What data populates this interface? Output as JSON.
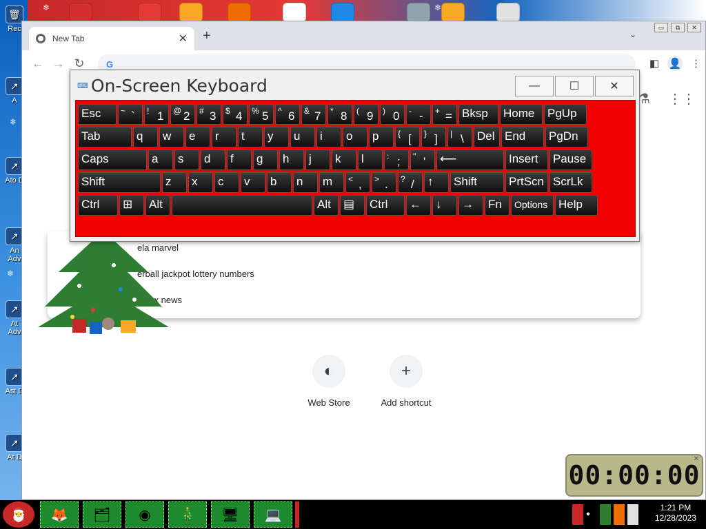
{
  "desktop": {
    "icons": [
      {
        "label": "Rec",
        "icon": "recycle-bin-icon"
      },
      {
        "label": "A",
        "icon": "shortcut-icon"
      },
      {
        "label": "Ato D",
        "icon": "shortcut-icon"
      },
      {
        "label": "An Adv",
        "icon": "shortcut-icon"
      },
      {
        "label": "At Adv",
        "icon": "shortcut-icon"
      },
      {
        "label": "Ast D",
        "icon": "shortcut-icon"
      },
      {
        "label": "At D",
        "icon": "shortcut-icon"
      }
    ]
  },
  "browser": {
    "tab": {
      "title": "New Tab"
    },
    "new_tab": "+",
    "tab_search": "⌄",
    "omnibox": {
      "google_mark": "G",
      "value": "",
      "placeholder": ""
    },
    "suggestions": [
      "ela marvel",
      "erball jackpot lottery numbers",
      "d sox news"
    ],
    "shortcuts": [
      {
        "label": "Web Store",
        "icon": "webstore-icon"
      },
      {
        "label": "Add shortcut",
        "icon": "plus-icon"
      }
    ]
  },
  "osk": {
    "title": "On-Screen Keyboard",
    "rows": [
      [
        {
          "main": "Esc",
          "w": 56
        },
        {
          "top": "~",
          "main": "`",
          "w": 36
        },
        {
          "top": "!",
          "main": "1",
          "w": 36
        },
        {
          "top": "@",
          "main": "2",
          "w": 36
        },
        {
          "top": "#",
          "main": "3",
          "w": 36
        },
        {
          "top": "$",
          "main": "4",
          "w": 36
        },
        {
          "top": "%",
          "main": "5",
          "w": 36
        },
        {
          "top": "^",
          "main": "6",
          "w": 36
        },
        {
          "top": "&",
          "main": "7",
          "w": 36
        },
        {
          "top": "*",
          "main": "8",
          "w": 36
        },
        {
          "top": "(",
          "main": "9",
          "w": 36
        },
        {
          "top": ")",
          "main": "0",
          "w": 36
        },
        {
          "top": "-",
          "main": "-",
          "w": 36
        },
        {
          "top": "+",
          "main": "=",
          "w": 36
        },
        {
          "main": "Bksp",
          "w": 58
        },
        {
          "main": "Home",
          "w": 62
        },
        {
          "main": "PgUp",
          "w": 62
        }
      ],
      [
        {
          "main": "Tab",
          "w": 78
        },
        {
          "main": "q",
          "w": 36
        },
        {
          "main": "w",
          "w": 36
        },
        {
          "main": "e",
          "w": 36
        },
        {
          "main": "r",
          "w": 36
        },
        {
          "main": "t",
          "w": 36
        },
        {
          "main": "y",
          "w": 36
        },
        {
          "main": "u",
          "w": 36
        },
        {
          "main": "i",
          "w": 36
        },
        {
          "main": "o",
          "w": 36
        },
        {
          "main": "p",
          "w": 36
        },
        {
          "top": "{",
          "main": "[",
          "w": 36
        },
        {
          "top": "}",
          "main": "]",
          "w": 36
        },
        {
          "top": "|",
          "main": "\\",
          "w": 36
        },
        {
          "main": "Del",
          "w": 38
        },
        {
          "main": "End",
          "w": 62
        },
        {
          "main": "PgDn",
          "w": 62
        }
      ],
      [
        {
          "main": "Caps",
          "w": 100
        },
        {
          "main": "a",
          "w": 36
        },
        {
          "main": "s",
          "w": 36
        },
        {
          "main": "d",
          "w": 36
        },
        {
          "main": "f",
          "w": 36
        },
        {
          "main": "g",
          "w": 36
        },
        {
          "main": "h",
          "w": 36
        },
        {
          "main": "j",
          "w": 36
        },
        {
          "main": "k",
          "w": 36
        },
        {
          "main": "l",
          "w": 36
        },
        {
          "top": ":",
          "main": ";",
          "w": 36
        },
        {
          "top": "\"",
          "main": "'",
          "w": 36
        },
        {
          "main": "⟵",
          "w": 98
        },
        {
          "main": "Insert",
          "w": 62
        },
        {
          "main": "Pause",
          "w": 62
        }
      ],
      [
        {
          "main": "Shift",
          "w": 120
        },
        {
          "main": "z",
          "w": 36
        },
        {
          "main": "x",
          "w": 36
        },
        {
          "main": "c",
          "w": 36
        },
        {
          "main": "v",
          "w": 36
        },
        {
          "main": "b",
          "w": 36
        },
        {
          "main": "n",
          "w": 36
        },
        {
          "main": "m",
          "w": 36
        },
        {
          "top": "<",
          "main": ",",
          "w": 36
        },
        {
          "top": ">",
          "main": ".",
          "w": 36
        },
        {
          "top": "?",
          "main": "/",
          "w": 36
        },
        {
          "main": "↑",
          "w": 36
        },
        {
          "main": "Shift",
          "w": 78
        },
        {
          "main": "PrtScn",
          "w": 62
        },
        {
          "main": "ScrLk",
          "w": 62
        }
      ],
      [
        {
          "main": "Ctrl",
          "w": 58
        },
        {
          "main": "⊞",
          "w": 36
        },
        {
          "main": "Alt",
          "w": 36
        },
        {
          "main": "",
          "w": 204
        },
        {
          "main": "Alt",
          "w": 36
        },
        {
          "main": "▤",
          "w": 36
        },
        {
          "main": "Ctrl",
          "w": 56
        },
        {
          "main": "←",
          "w": 36
        },
        {
          "main": "↓",
          "w": 36
        },
        {
          "main": "→",
          "w": 36
        },
        {
          "main": "Fn",
          "w": 36
        },
        {
          "main": "Options",
          "w": 62,
          "small": true
        },
        {
          "main": "Help",
          "w": 62
        }
      ]
    ]
  },
  "timer": {
    "display": "00:00:00"
  },
  "taskbar": {
    "apps": [
      "firefox-icon",
      "file-explorer-icon",
      "chrome-icon",
      "tree-icon",
      "control-panel-icon",
      "computer-icon"
    ],
    "time": "1:21 PM",
    "date": "12/28/2023"
  }
}
